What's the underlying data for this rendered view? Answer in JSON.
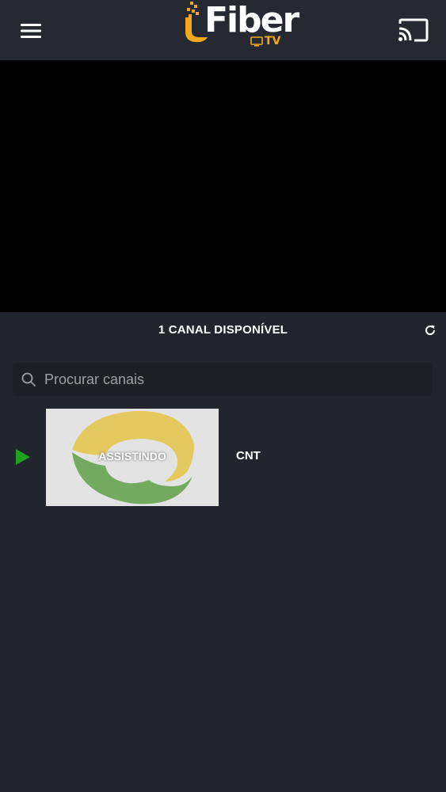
{
  "header": {
    "logo_text": "Fiber",
    "logo_sub": "TV",
    "menu_icon": "hamburger-menu-icon",
    "cast_icon": "cast-icon"
  },
  "channels": {
    "count_label": "1 CANAL DISPONÍVEL",
    "refresh_icon": "refresh-icon"
  },
  "search": {
    "placeholder": "Procurar canais",
    "value": ""
  },
  "channel_list": [
    {
      "name": "CNT",
      "status_label": "ASSISTINDO",
      "playing": true
    }
  ],
  "colors": {
    "background": "#22252d",
    "header": "#262931",
    "video": "#000000",
    "accent": "#f2a81d",
    "play": "#1ea11e",
    "logo_yellow": "#e8c020",
    "logo_green": "#3f8a22"
  }
}
